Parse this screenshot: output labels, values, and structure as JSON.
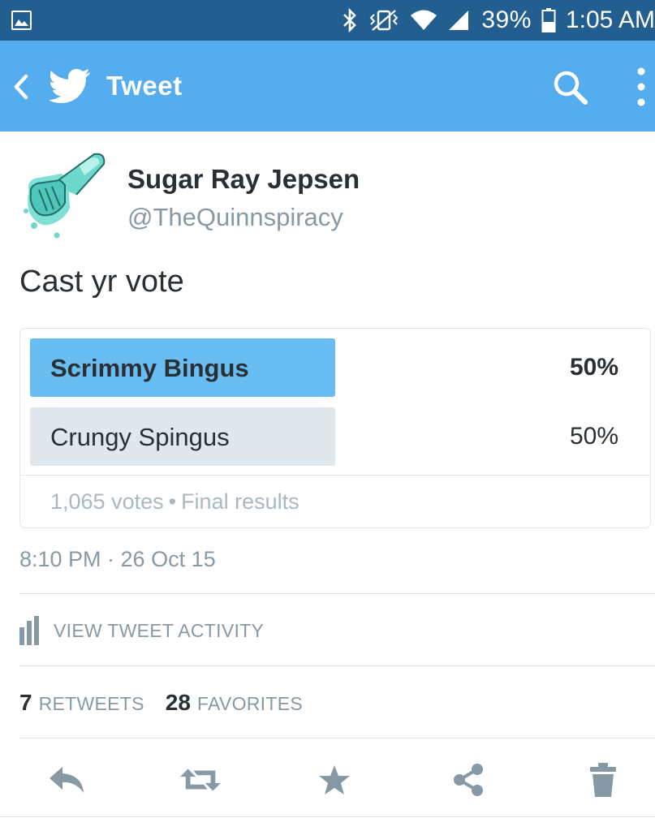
{
  "status_bar": {
    "battery": "39%",
    "time": "1:05 AM",
    "icons": [
      "gallery-icon",
      "bluetooth-icon",
      "vibrate-icon",
      "wifi-icon",
      "signal-icon",
      "battery-icon"
    ]
  },
  "app_bar": {
    "title": "Tweet",
    "icons": [
      "back-icon",
      "twitter-bird-icon",
      "search-icon",
      "more-vert-icon"
    ],
    "color": "#55acee"
  },
  "tweet": {
    "author_name": "Sugar Ray Jepsen",
    "author_handle": "@TheQuinnspiracy",
    "text": "Cast yr vote",
    "timestamp": "8:10 PM · 26 Oct 15"
  },
  "poll": {
    "options": [
      {
        "label": "Scrimmy Bingus",
        "percent": "50%",
        "share": 0.5,
        "winner": true
      },
      {
        "label": "Crungy Spingus",
        "percent": "50%",
        "share": 0.5,
        "winner": false
      }
    ],
    "votes": "1,065 votes",
    "separator": "•",
    "status": "Final results",
    "bar_colors": {
      "winner": "#68bdf3",
      "other": "#e1e8ed"
    }
  },
  "activity": {
    "label": "VIEW TWEET ACTIVITY",
    "icon": "bar-chart-icon"
  },
  "stats": {
    "retweets_count": "7",
    "retweets_label": "RETWEETS",
    "favorites_count": "28",
    "favorites_label": "FAVORITES"
  },
  "actions": [
    "reply-icon",
    "retweet-icon",
    "favorite-icon",
    "share-icon",
    "delete-icon"
  ]
}
